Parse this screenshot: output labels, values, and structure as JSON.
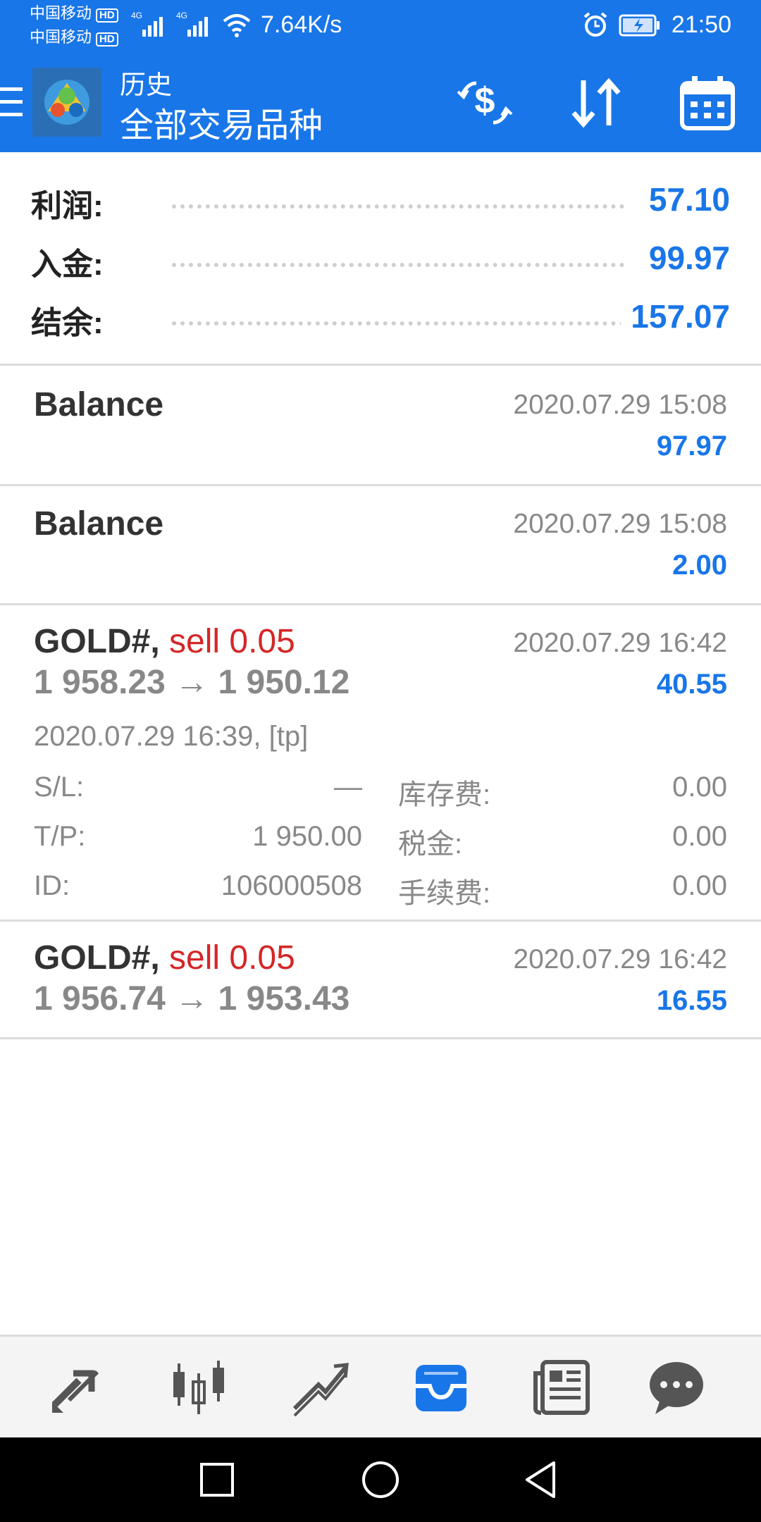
{
  "status_bar": {
    "carrier_1": "中国移动",
    "carrier_2": "中国移动",
    "hd_badge": "HD",
    "network": "4G",
    "speed": "7.64K/s",
    "time": "21:50",
    "icons": [
      "signal-icon",
      "wifi-icon",
      "alarm-icon",
      "battery-charging-icon"
    ]
  },
  "toolbar": {
    "title": "历史",
    "subtitle": "全部交易品种",
    "buttons": [
      "currency-exchange-icon",
      "sort-icon",
      "calendar-icon"
    ]
  },
  "summary": {
    "profit_label": "利润:",
    "profit_value": "57.10",
    "deposit_label": "入金:",
    "deposit_value": "99.97",
    "balance_label": "结余:",
    "balance_value": "157.07"
  },
  "entries": [
    {
      "title": "Balance",
      "date": "2020.07.29 15:08",
      "amount": "97.97"
    },
    {
      "title": "Balance",
      "date": "2020.07.29 15:08",
      "amount": "2.00"
    },
    {
      "symbol": "GOLD#,",
      "action": "sell 0.05",
      "date": "2020.07.29 16:42",
      "prices": "1 958.23 → 1 950.12",
      "amount": "40.55",
      "open_info": "2020.07.29 16:39, [tp]",
      "details": {
        "sl_label": "S/L:",
        "sl_value": "—",
        "tp_label": "T/P:",
        "tp_value": "1 950.00",
        "id_label": "ID:",
        "id_value": "106000508",
        "swap_label": "库存费:",
        "swap_value": "0.00",
        "tax_label": "税金:",
        "tax_value": "0.00",
        "fee_label": "手续费:",
        "fee_value": "0.00"
      }
    },
    {
      "symbol": "GOLD#,",
      "action": "sell 0.05",
      "date": "2020.07.29 16:42",
      "prices": "1 956.74 → 1 953.43",
      "amount": "16.55"
    }
  ],
  "bottom_nav": {
    "items": [
      "trade-icon",
      "quotes-candles-icon",
      "chart-icon",
      "history-inbox-icon",
      "news-icon",
      "chat-icon"
    ],
    "active": "history-inbox-icon",
    "active_color": "#1976e8"
  },
  "colors": {
    "accent": "#1976e8",
    "sell": "#d42727",
    "muted": "#888888"
  }
}
